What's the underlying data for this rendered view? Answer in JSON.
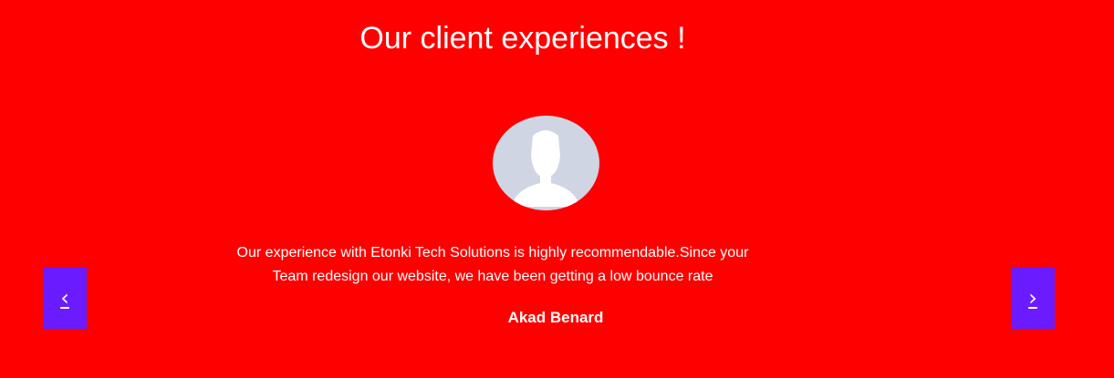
{
  "section": {
    "title": "Our client experiences !",
    "background_color": "#ff0000",
    "button_color": "#6a1bff"
  },
  "testimonial": {
    "avatar_icon": "user-silhouette-icon",
    "quote": "Our experience with Etonki Tech Solutions is highly recommendable.Since your Team redesign our website, we have been getting a low bounce rate",
    "client_name": "Akad Benard"
  },
  "carousel": {
    "prev_label": "‹",
    "next_label": "›"
  }
}
